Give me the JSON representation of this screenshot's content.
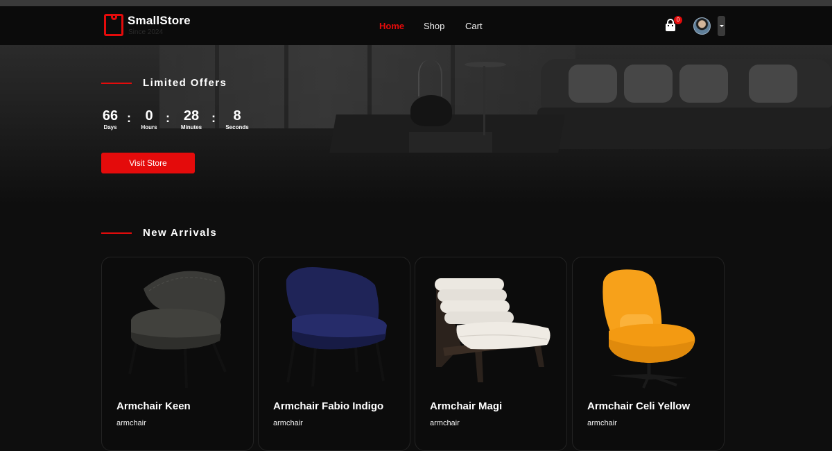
{
  "brand": {
    "name": "SmallStore",
    "tagline": "Since 2024"
  },
  "nav": {
    "home": "Home",
    "shop": "Shop",
    "cart": "Cart"
  },
  "cart": {
    "count": "0"
  },
  "colors": {
    "accent": "#e40b0b",
    "background": "#0e0e0e"
  },
  "offers": {
    "title": "Limited Offers",
    "countdown": {
      "days": "66",
      "days_label": "Days",
      "hours": "0",
      "hours_label": "Hours",
      "minutes": "28",
      "minutes_label": "Minutes",
      "seconds": "8",
      "seconds_label": "Seconds",
      "separator": ":"
    },
    "cta": "Visit Store"
  },
  "arrivals": {
    "title": "New Arrivals",
    "products": [
      {
        "name": "Armchair Keen",
        "category": "armchair",
        "color": "#3b3b38"
      },
      {
        "name": "Armchair Fabio Indigo",
        "category": "armchair",
        "color": "#1f2458"
      },
      {
        "name": "Armchair Magi",
        "category": "armchair",
        "color": "#e7e3dc"
      },
      {
        "name": "Armchair Celi Yellow",
        "category": "armchair",
        "color": "#f7a11a"
      }
    ]
  }
}
